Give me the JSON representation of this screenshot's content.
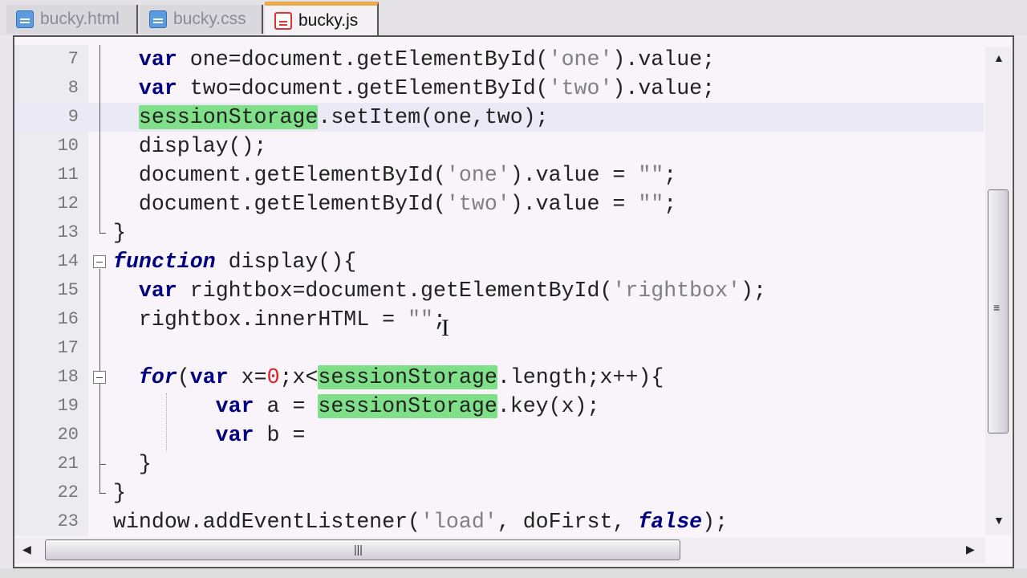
{
  "tabs": [
    {
      "label": "bucky.html",
      "icon": "save-disk-icon",
      "color": "#5b9be0",
      "active": false
    },
    {
      "label": "bucky.css",
      "icon": "save-disk-icon",
      "color": "#5b9be0",
      "active": false
    },
    {
      "label": "bucky.js",
      "icon": "save-disk-icon-modified",
      "color": "#dd3333",
      "active": true
    }
  ],
  "editor": {
    "current_line": 9,
    "lines": [
      {
        "n": "7",
        "tokens": [
          [
            "",
            "  "
          ],
          [
            "k",
            "var"
          ],
          [
            "",
            " one=document.getElementById("
          ],
          [
            "s",
            "'one'"
          ],
          [
            "",
            ").value;"
          ]
        ]
      },
      {
        "n": "8",
        "tokens": [
          [
            "",
            "  "
          ],
          [
            "k",
            "var"
          ],
          [
            "",
            " two=document.getElementById("
          ],
          [
            "s",
            "'two'"
          ],
          [
            "",
            ").value;"
          ]
        ]
      },
      {
        "n": "9",
        "tokens": [
          [
            "",
            "  "
          ],
          [
            "h",
            "sessionStorage"
          ],
          [
            "",
            ".setItem(one,two);"
          ]
        ]
      },
      {
        "n": "10",
        "tokens": [
          [
            "",
            "  display();"
          ]
        ]
      },
      {
        "n": "11",
        "tokens": [
          [
            "",
            "  document.getElementById("
          ],
          [
            "s",
            "'one'"
          ],
          [
            "",
            ").value = "
          ],
          [
            "s",
            "\"\""
          ],
          [
            "",
            ";"
          ]
        ]
      },
      {
        "n": "12",
        "tokens": [
          [
            "",
            "  document.getElementById("
          ],
          [
            "s",
            "'two'"
          ],
          [
            "",
            ").value = "
          ],
          [
            "s",
            "\"\""
          ],
          [
            "",
            ";"
          ]
        ]
      },
      {
        "n": "13",
        "tokens": [
          [
            "",
            "}"
          ]
        ]
      },
      {
        "n": "14",
        "tokens": [
          [
            "i",
            "function"
          ],
          [
            "",
            " display(){"
          ]
        ]
      },
      {
        "n": "15",
        "tokens": [
          [
            "",
            "  "
          ],
          [
            "k",
            "var"
          ],
          [
            "",
            " rightbox=document.getElementById("
          ],
          [
            "s",
            "'rightbox'"
          ],
          [
            "",
            ");"
          ]
        ]
      },
      {
        "n": "16",
        "tokens": [
          [
            "",
            "  rightbox.innerHTML = "
          ],
          [
            "s",
            "\"\""
          ],
          [
            "",
            ";"
          ]
        ]
      },
      {
        "n": "17",
        "tokens": []
      },
      {
        "n": "18",
        "tokens": [
          [
            "",
            "  "
          ],
          [
            "i",
            "for"
          ],
          [
            "",
            "("
          ],
          [
            "k",
            "var"
          ],
          [
            "",
            " x="
          ],
          [
            "n",
            "0"
          ],
          [
            "",
            ";x<"
          ],
          [
            "h",
            "sessionStorage"
          ],
          [
            "",
            ".length;x++){"
          ]
        ]
      },
      {
        "n": "19",
        "tokens": [
          [
            "",
            "        "
          ],
          [
            "k",
            "var"
          ],
          [
            "",
            " a = "
          ],
          [
            "h",
            "sessionStorage"
          ],
          [
            "",
            ".key(x);"
          ]
        ]
      },
      {
        "n": "20",
        "tokens": [
          [
            "",
            "        "
          ],
          [
            "k",
            "var"
          ],
          [
            "",
            " b ="
          ]
        ]
      },
      {
        "n": "21",
        "tokens": [
          [
            "",
            "  }"
          ]
        ]
      },
      {
        "n": "22",
        "tokens": [
          [
            "",
            "}"
          ]
        ]
      },
      {
        "n": "23",
        "tokens": [
          [
            "",
            "window.addEventListener("
          ],
          [
            "s",
            "'load'"
          ],
          [
            "",
            ", doFirst, "
          ],
          [
            "i",
            "false"
          ],
          [
            "",
            ");"
          ]
        ]
      }
    ]
  },
  "colors": {
    "keyword": "#000080",
    "string": "#808080",
    "number": "#e02020",
    "highlight": "#80e089",
    "active_tab_accent": "#eaa94a"
  }
}
